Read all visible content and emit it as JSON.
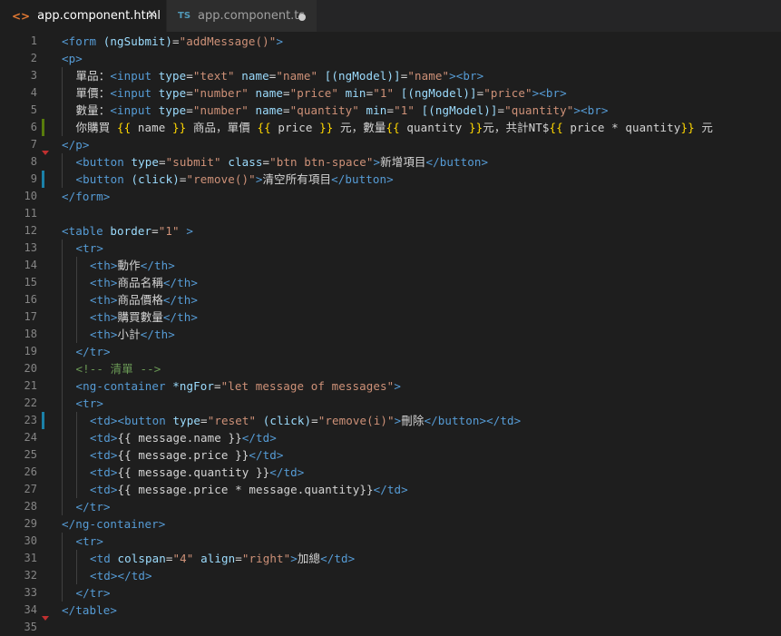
{
  "tabs": [
    {
      "label": "app.component.html",
      "icon": "html-file-icon",
      "icon_glyph": "<>",
      "close_glyph": "✕"
    },
    {
      "label": "app.component.ts",
      "icon": "ts-file-icon",
      "icon_glyph": "TS"
    }
  ],
  "colors": {
    "tag": "#569cd6",
    "attr": "#9cdcfe",
    "str": "#ce9178",
    "cmt": "#6a9955",
    "brk": "#ffd700",
    "pln": "#d4d4d4",
    "modified": "#587c0c",
    "added": "#1b81a8"
  },
  "lines": [
    {
      "n": "1",
      "indent": 0,
      "segs": [
        [
          "tag",
          "<form "
        ],
        [
          "attr",
          "(ngSubmit)"
        ],
        [
          "pln",
          "="
        ],
        [
          "str",
          "\"addMessage()\""
        ],
        [
          "tag",
          ">"
        ]
      ]
    },
    {
      "n": "2",
      "indent": 0,
      "segs": [
        [
          "tag",
          "<p>"
        ]
      ]
    },
    {
      "n": "3",
      "indent": 1,
      "segs": [
        [
          "pln",
          "單品："
        ],
        [
          "tag",
          "<input "
        ],
        [
          "attr",
          "type"
        ],
        [
          "pln",
          "="
        ],
        [
          "str",
          "\"text\" "
        ],
        [
          "attr",
          "name"
        ],
        [
          "pln",
          "="
        ],
        [
          "str",
          "\"name\" "
        ],
        [
          "attr",
          "[(ngModel)]"
        ],
        [
          "pln",
          "="
        ],
        [
          "str",
          "\"name\""
        ],
        [
          "tag",
          ">"
        ],
        [
          "tag",
          "<br>"
        ]
      ]
    },
    {
      "n": "4",
      "indent": 1,
      "segs": [
        [
          "pln",
          "單價："
        ],
        [
          "tag",
          "<input "
        ],
        [
          "attr",
          "type"
        ],
        [
          "pln",
          "="
        ],
        [
          "str",
          "\"number\" "
        ],
        [
          "attr",
          "name"
        ],
        [
          "pln",
          "="
        ],
        [
          "str",
          "\"price\" "
        ],
        [
          "attr",
          "min"
        ],
        [
          "pln",
          "="
        ],
        [
          "str",
          "\"1\" "
        ],
        [
          "attr",
          "[(ngModel)]"
        ],
        [
          "pln",
          "="
        ],
        [
          "str",
          "\"price\""
        ],
        [
          "tag",
          ">"
        ],
        [
          "tag",
          "<br>"
        ]
      ]
    },
    {
      "n": "5",
      "indent": 1,
      "segs": [
        [
          "pln",
          "數量："
        ],
        [
          "tag",
          "<input "
        ],
        [
          "attr",
          "type"
        ],
        [
          "pln",
          "="
        ],
        [
          "str",
          "\"number\" "
        ],
        [
          "attr",
          "name"
        ],
        [
          "pln",
          "="
        ],
        [
          "str",
          "\"quantity\" "
        ],
        [
          "attr",
          "min"
        ],
        [
          "pln",
          "="
        ],
        [
          "str",
          "\"1\" "
        ],
        [
          "attr",
          "[(ngModel)]"
        ],
        [
          "pln",
          "="
        ],
        [
          "str",
          "\"quantity\""
        ],
        [
          "tag",
          ">"
        ],
        [
          "tag",
          "<br>"
        ]
      ]
    },
    {
      "n": "6",
      "indent": 1,
      "mark": "modified",
      "segs": [
        [
          "pln",
          "你購買 "
        ],
        [
          "brk",
          "{{"
        ],
        [
          "pln",
          " name "
        ],
        [
          "brk",
          "}}"
        ],
        [
          "pln",
          " 商品，單價 "
        ],
        [
          "brk",
          "{{"
        ],
        [
          "pln",
          " price "
        ],
        [
          "brk",
          "}}"
        ],
        [
          "pln",
          " 元，數量"
        ],
        [
          "brk",
          "{{"
        ],
        [
          "pln",
          " quantity "
        ],
        [
          "brk",
          "}}"
        ],
        [
          "pln",
          "元，共計NT$"
        ],
        [
          "brk",
          "{{"
        ],
        [
          "pln",
          " price * quantity"
        ],
        [
          "brk",
          "}}"
        ],
        [
          "pln",
          " 元"
        ]
      ]
    },
    {
      "n": "7",
      "indent": 0,
      "segs": [
        [
          "tag",
          "</p>"
        ]
      ]
    },
    {
      "n": "8",
      "indent": 1,
      "segs": [
        [
          "tag",
          "<button "
        ],
        [
          "attr",
          "type"
        ],
        [
          "pln",
          "="
        ],
        [
          "str",
          "\"submit\" "
        ],
        [
          "attr",
          "class"
        ],
        [
          "pln",
          "="
        ],
        [
          "str",
          "\"btn btn-space\""
        ],
        [
          "tag",
          ">"
        ],
        [
          "pln",
          "新增項目"
        ],
        [
          "tag",
          "</button>"
        ]
      ]
    },
    {
      "n": "9",
      "indent": 1,
      "mark": "added",
      "segs": [
        [
          "tag",
          "<button "
        ],
        [
          "attr",
          "(click)"
        ],
        [
          "pln",
          "="
        ],
        [
          "str",
          "\"remove()\""
        ],
        [
          "tag",
          ">"
        ],
        [
          "pln",
          "清空所有項目"
        ],
        [
          "tag",
          "</button>"
        ]
      ]
    },
    {
      "n": "10",
      "indent": 0,
      "segs": [
        [
          "tag",
          "</form>"
        ]
      ]
    },
    {
      "n": "11",
      "indent": 0,
      "segs": []
    },
    {
      "n": "12",
      "indent": 0,
      "segs": [
        [
          "tag",
          "<table "
        ],
        [
          "attr",
          "border"
        ],
        [
          "pln",
          "="
        ],
        [
          "str",
          "\"1\""
        ],
        [
          "tag",
          " >"
        ]
      ]
    },
    {
      "n": "13",
      "indent": 1,
      "segs": [
        [
          "tag",
          "<tr>"
        ]
      ]
    },
    {
      "n": "14",
      "indent": 2,
      "segs": [
        [
          "tag",
          "<th>"
        ],
        [
          "pln",
          "動作"
        ],
        [
          "tag",
          "</th>"
        ]
      ]
    },
    {
      "n": "15",
      "indent": 2,
      "segs": [
        [
          "tag",
          "<th>"
        ],
        [
          "pln",
          "商品名稱"
        ],
        [
          "tag",
          "</th>"
        ]
      ]
    },
    {
      "n": "16",
      "indent": 2,
      "segs": [
        [
          "tag",
          "<th>"
        ],
        [
          "pln",
          "商品價格"
        ],
        [
          "tag",
          "</th>"
        ]
      ]
    },
    {
      "n": "17",
      "indent": 2,
      "segs": [
        [
          "tag",
          "<th>"
        ],
        [
          "pln",
          "購買數量"
        ],
        [
          "tag",
          "</th>"
        ]
      ]
    },
    {
      "n": "18",
      "indent": 2,
      "segs": [
        [
          "tag",
          "<th>"
        ],
        [
          "pln",
          "小計"
        ],
        [
          "tag",
          "</th>"
        ]
      ]
    },
    {
      "n": "19",
      "indent": 1,
      "segs": [
        [
          "tag",
          "</tr>"
        ]
      ]
    },
    {
      "n": "20",
      "indent": 1,
      "segs": [
        [
          "cmt",
          "<!-- 清單 -->"
        ]
      ]
    },
    {
      "n": "21",
      "indent": 1,
      "segs": [
        [
          "tag",
          "<ng-container "
        ],
        [
          "attr",
          "*ngFor"
        ],
        [
          "pln",
          "="
        ],
        [
          "str",
          "\"let message of messages\""
        ],
        [
          "tag",
          ">"
        ]
      ]
    },
    {
      "n": "22",
      "indent": 1,
      "segs": [
        [
          "tag",
          "<tr>"
        ]
      ]
    },
    {
      "n": "23",
      "indent": 2,
      "mark": "added",
      "segs": [
        [
          "tag",
          "<td>"
        ],
        [
          "tag",
          "<button "
        ],
        [
          "attr",
          "type"
        ],
        [
          "pln",
          "="
        ],
        [
          "str",
          "\"reset\" "
        ],
        [
          "attr",
          "(click)"
        ],
        [
          "pln",
          "="
        ],
        [
          "str",
          "\"remove(i)\""
        ],
        [
          "tag",
          ">"
        ],
        [
          "pln",
          "刪除"
        ],
        [
          "tag",
          "</button>"
        ],
        [
          "tag",
          "</td>"
        ]
      ]
    },
    {
      "n": "24",
      "indent": 2,
      "segs": [
        [
          "tag",
          "<td>"
        ],
        [
          "pln",
          "{{ message.name }}"
        ],
        [
          "tag",
          "</td>"
        ]
      ]
    },
    {
      "n": "25",
      "indent": 2,
      "segs": [
        [
          "tag",
          "<td>"
        ],
        [
          "pln",
          "{{ message.price }}"
        ],
        [
          "tag",
          "</td>"
        ]
      ]
    },
    {
      "n": "26",
      "indent": 2,
      "segs": [
        [
          "tag",
          "<td>"
        ],
        [
          "pln",
          "{{ message.quantity }}"
        ],
        [
          "tag",
          "</td>"
        ]
      ]
    },
    {
      "n": "27",
      "indent": 2,
      "segs": [
        [
          "tag",
          "<td>"
        ],
        [
          "pln",
          "{{ message.price * message.quantity}}"
        ],
        [
          "tag",
          "</td>"
        ]
      ]
    },
    {
      "n": "28",
      "indent": 1,
      "segs": [
        [
          "tag",
          "</tr>"
        ]
      ]
    },
    {
      "n": "29",
      "indent": 0,
      "segs": [
        [
          "tag",
          "</ng-container>"
        ]
      ]
    },
    {
      "n": "30",
      "indent": 1,
      "segs": [
        [
          "tag",
          "<tr>"
        ]
      ]
    },
    {
      "n": "31",
      "indent": 2,
      "segs": [
        [
          "tag",
          "<td "
        ],
        [
          "attr",
          "colspan"
        ],
        [
          "pln",
          "="
        ],
        [
          "str",
          "\"4\" "
        ],
        [
          "attr",
          "align"
        ],
        [
          "pln",
          "="
        ],
        [
          "str",
          "\"right\""
        ],
        [
          "tag",
          ">"
        ],
        [
          "pln",
          "加總"
        ],
        [
          "tag",
          "</td>"
        ]
      ]
    },
    {
      "n": "32",
      "indent": 2,
      "segs": [
        [
          "tag",
          "<td>"
        ],
        [
          "tag",
          "</td>"
        ]
      ]
    },
    {
      "n": "33",
      "indent": 1,
      "segs": [
        [
          "tag",
          "</tr>"
        ]
      ]
    },
    {
      "n": "34",
      "indent": 0,
      "segs": [
        [
          "tag",
          "</table>"
        ]
      ]
    },
    {
      "n": "35",
      "indent": 0,
      "segs": []
    }
  ]
}
